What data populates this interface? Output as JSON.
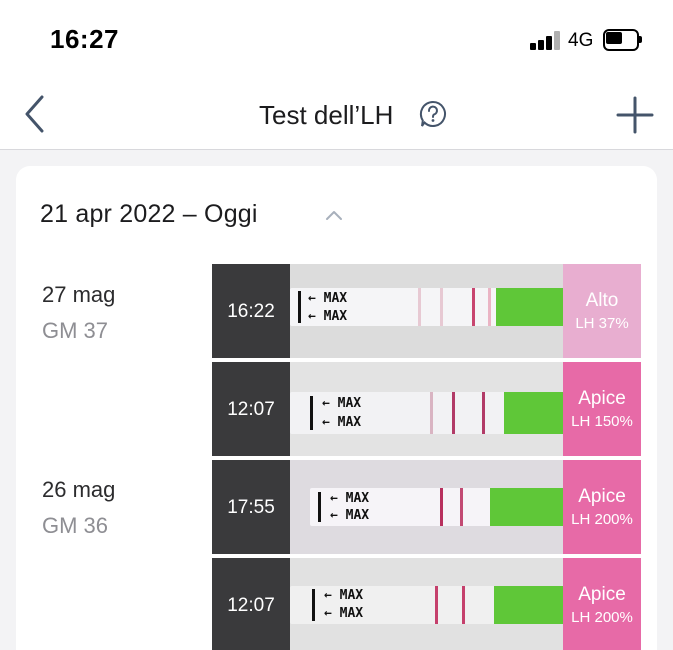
{
  "status_bar": {
    "time": "16:27",
    "network": "4G"
  },
  "nav": {
    "title": "Test dell’LH"
  },
  "card": {
    "range_label": "21 apr 2022 – Oggi",
    "days": [
      {
        "date": "27 mag",
        "cycle_day": "GM 37"
      },
      {
        "date": "26 mag",
        "cycle_day": "GM 36"
      }
    ],
    "tests": [
      {
        "time": "16:22",
        "result": "Alto",
        "lh": "LH 37%",
        "color": "#e8aed0"
      },
      {
        "time": "12:07",
        "result": "Apice",
        "lh": "LH 150%",
        "color": "#e76aa7"
      },
      {
        "time": "17:55",
        "result": "Apice",
        "lh": "LH 200%",
        "color": "#e76aa7"
      },
      {
        "time": "12:07",
        "result": "Apice",
        "lh": "LH 200%",
        "color": "#e76aa7"
      }
    ],
    "strip_marking": "← MAX"
  }
}
